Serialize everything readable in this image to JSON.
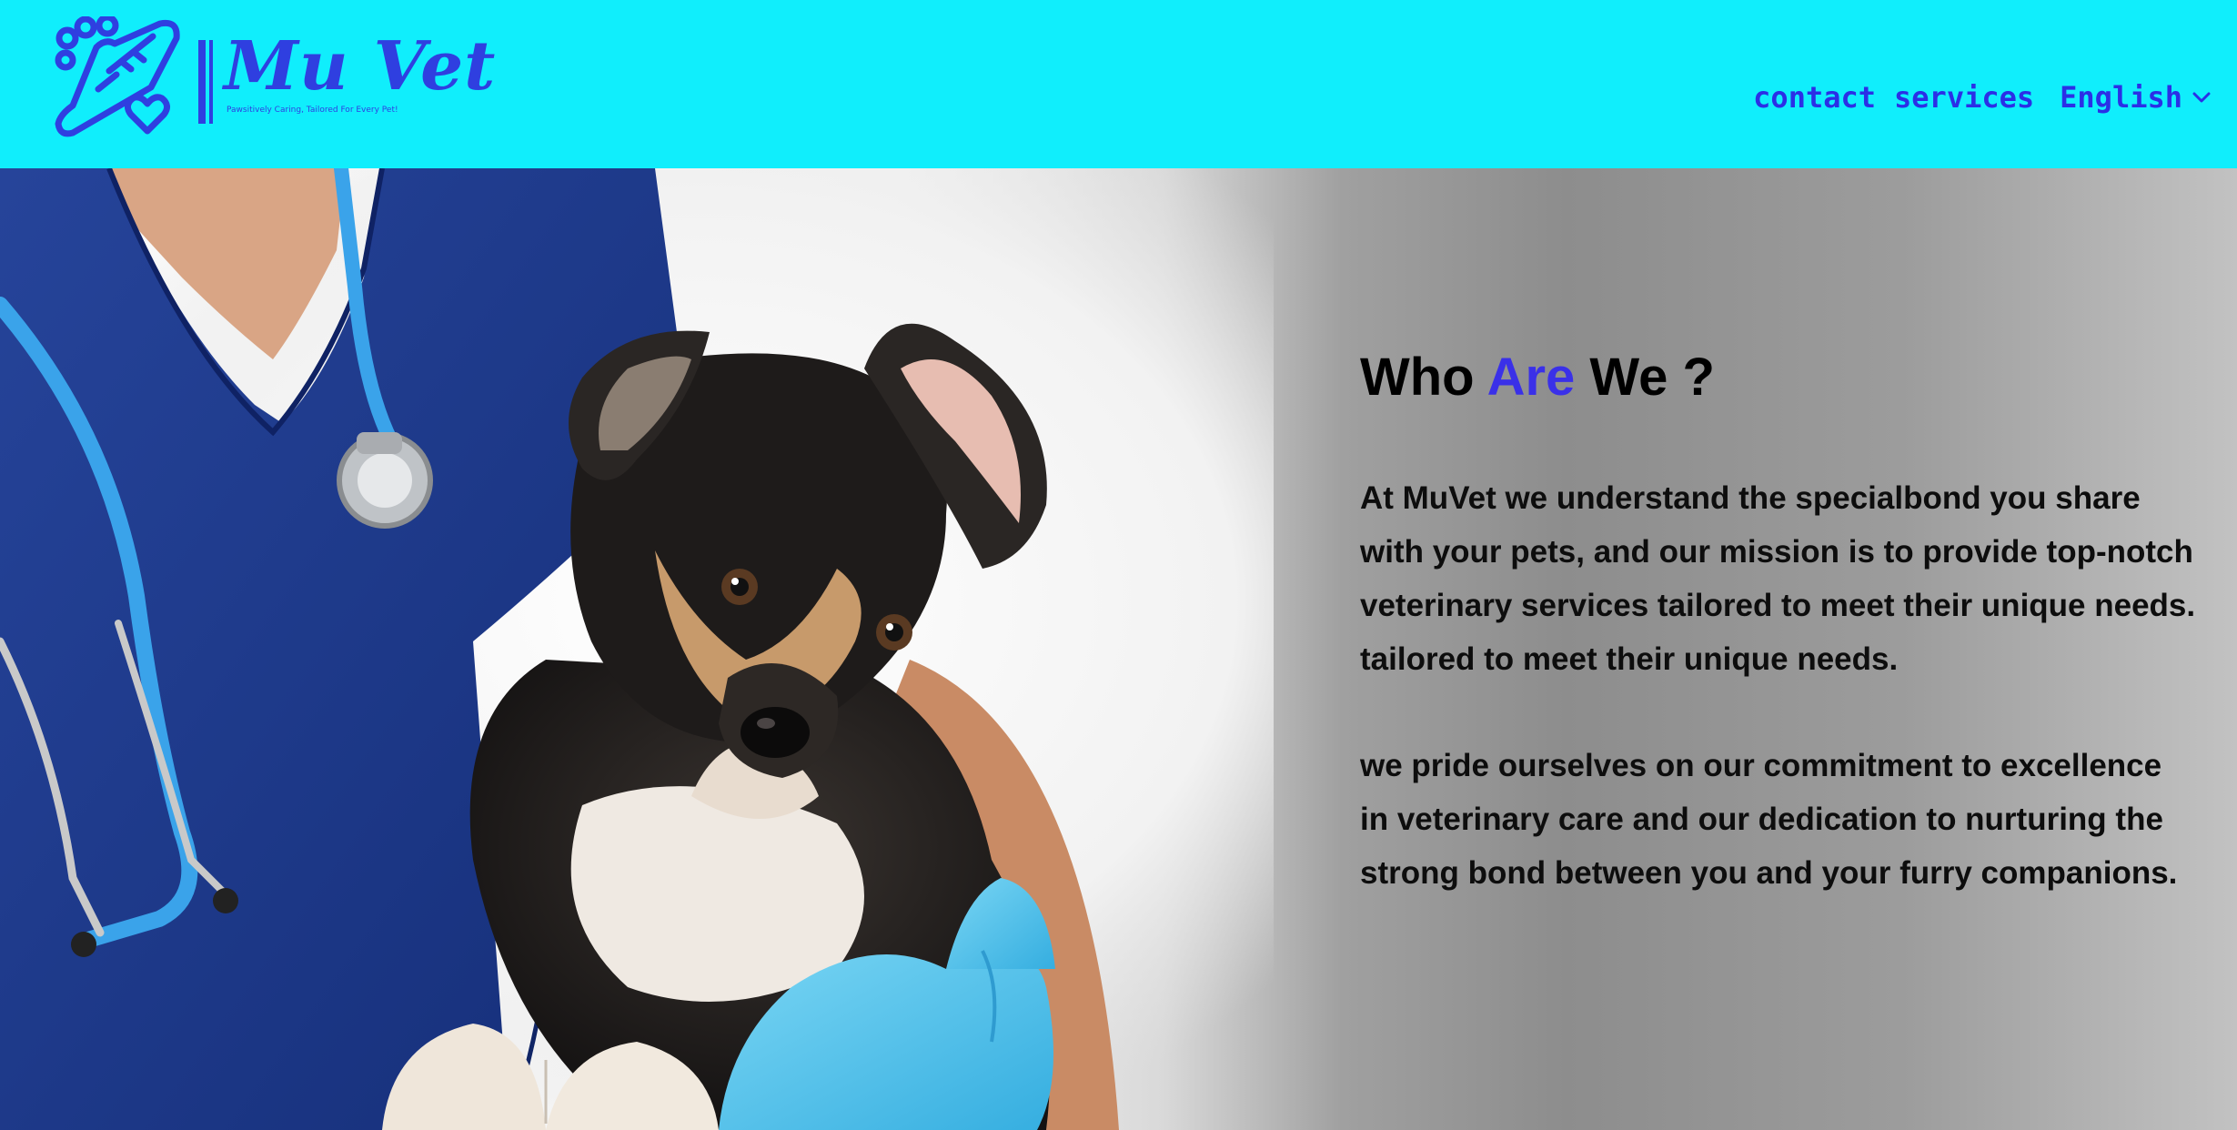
{
  "brand": {
    "name": "Mu Vet",
    "tagline": "Pawsitively Caring, Tailored For Every Pet!"
  },
  "nav": {
    "contact": "contact",
    "services": "services",
    "language": "English"
  },
  "hero": {
    "heading": {
      "part1": "Who",
      "accent": "Are",
      "part2": "We ?"
    },
    "paragraph1": "At MuVet we understand the specialbond you share with your pets, and our mission is to provide top-notch veterinary services tailored to meet their unique needs. tailored to meet their unique needs.",
    "paragraph2": "we pride ourselves on our commitment to excellence in veterinary care and our dedication to nurturing the strong bond between you and your furry companions."
  },
  "icons": {
    "logo": "paw-thermometer-heart-icon",
    "language_dropdown": "chevron-down-icon"
  },
  "colors": {
    "header_bg": "#10eefc",
    "brand": "#2f3fe0",
    "nav_text": "#2b2fe6",
    "accent": "#3a30e8",
    "scrub_blue": "#1d3a8c",
    "glove_blue": "#4fc2ea"
  }
}
